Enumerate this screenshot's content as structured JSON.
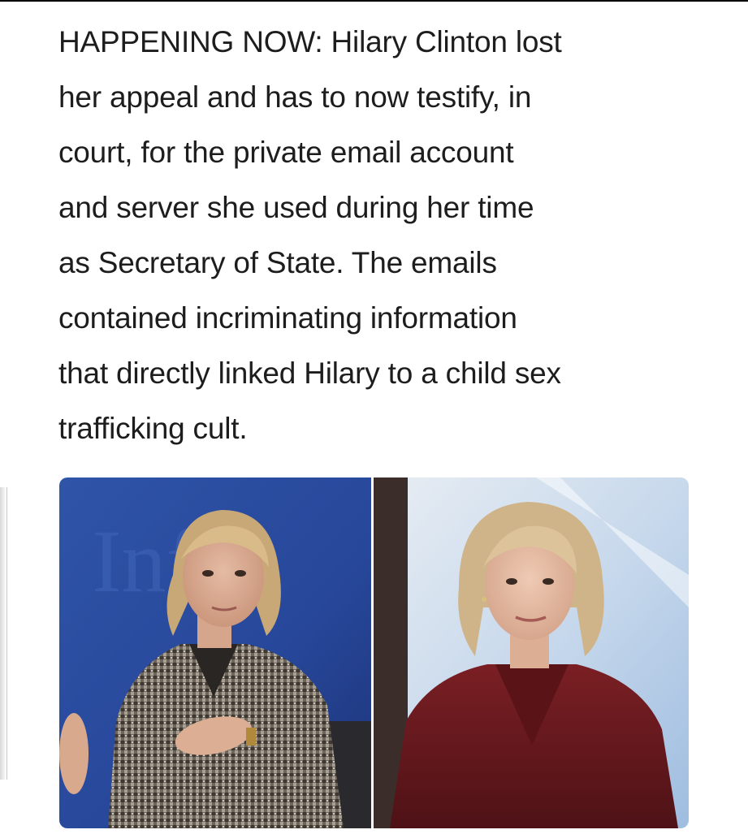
{
  "post": {
    "lines": [
      "HAPPENING NOW: Hilary Clinton lost",
      "her appeal and has to now testify, in",
      "court, for the private email account",
      "and server she used during her time",
      "as Secretary of State. The emails",
      "contained incriminating information",
      "that directly linked Hilary to a child sex",
      "trafficking cult."
    ]
  },
  "images": {
    "left": {
      "subject": "woman in tweed jacket gesturing, blue stage background",
      "backdrop_text": "Inf"
    },
    "right": {
      "subject": "woman in dark red blazer, light blue background"
    }
  },
  "colors": {
    "text": "#1d1d1d",
    "left_background": "#2b4d9e",
    "right_background": "#b9cfe6",
    "red_blazer": "#6b1a1e"
  }
}
